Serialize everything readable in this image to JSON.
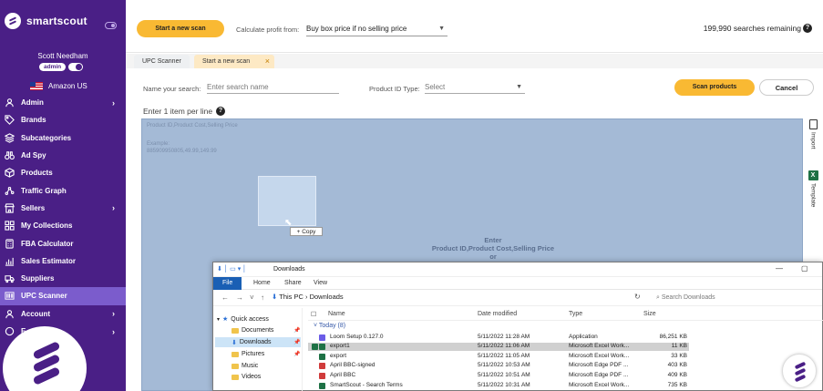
{
  "brand": {
    "name": "smartscout"
  },
  "user": {
    "name": "Scott Needham",
    "role_badge": "admin"
  },
  "marketplace": {
    "label": "Amazon US"
  },
  "sidebar": {
    "items": [
      {
        "label": "Admin",
        "icon": "person-icon",
        "chevron": true
      },
      {
        "label": "Brands",
        "icon": "tag-icon",
        "chevron": false
      },
      {
        "label": "Subcategories",
        "icon": "layers-icon",
        "chevron": false
      },
      {
        "label": "Ad Spy",
        "icon": "binoculars-icon",
        "chevron": false
      },
      {
        "label": "Products",
        "icon": "box-icon",
        "chevron": false
      },
      {
        "label": "Traffic Graph",
        "icon": "graph-icon",
        "chevron": false
      },
      {
        "label": "Sellers",
        "icon": "store-icon",
        "chevron": true
      },
      {
        "label": "My Collections",
        "icon": "grid-icon",
        "chevron": false
      },
      {
        "label": "FBA Calculator",
        "icon": "calculator-icon",
        "chevron": false
      },
      {
        "label": "Sales Estimator",
        "icon": "chart-icon",
        "chevron": false
      },
      {
        "label": "Suppliers",
        "icon": "truck-icon",
        "chevron": false
      },
      {
        "label": "UPC Scanner",
        "icon": "barcode-icon",
        "chevron": false,
        "active": true
      },
      {
        "label": "Account",
        "icon": "person-icon",
        "chevron": true
      },
      {
        "label": "E",
        "icon": "help-icon",
        "chevron": true
      }
    ]
  },
  "topbar": {
    "start_scan_label": "Start a new scan",
    "calc_label": "Calculate profit from:",
    "calc_value": "Buy box price if no selling price",
    "searches_remaining": "199,990 searches remaining"
  },
  "tabs": [
    {
      "label": "UPC Scanner"
    },
    {
      "label": "Start a new scan",
      "closable": true
    }
  ],
  "form": {
    "name_label": "Name your search:",
    "name_placeholder": "Enter search name",
    "idtype_label": "Product ID Type:",
    "idtype_value": "Select",
    "scan_label": "Scan products",
    "cancel_label": "Cancel",
    "enter_label": "Enter 1 item per line"
  },
  "dropzone": {
    "ghost_line1": "Product ID,Product Cost,Selling Price",
    "ghost_line2": "Example:",
    "ghost_line3": "885909950805,49.99,149.99",
    "center_line1": "Enter",
    "center_line2": "Product ID,Product Cost,Selling Price",
    "center_line3": "or",
    "copy_badge": "+ Copy"
  },
  "rail": {
    "import_label": "Import",
    "template_label": "Template"
  },
  "explorer": {
    "title": "Downloads",
    "ribbon": [
      "File",
      "Home",
      "Share",
      "View"
    ],
    "path": "This PC  ›  Downloads",
    "search_placeholder": "Search Downloads",
    "columns": {
      "name": "Name",
      "date": "Date modified",
      "type": "Type",
      "size": "Size"
    },
    "group": "Today (8)",
    "tree": [
      {
        "label": "Quick access",
        "pinned": false
      },
      {
        "label": "Documents",
        "pinned": true
      },
      {
        "label": "Downloads",
        "pinned": true,
        "selected": true
      },
      {
        "label": "Pictures",
        "pinned": true
      },
      {
        "label": "Music",
        "pinned": false
      },
      {
        "label": "Videos",
        "pinned": false
      }
    ],
    "files": [
      {
        "name": "Loom Setup 0.127.0",
        "date": "5/11/2022 11:28 AM",
        "type": "Application",
        "size": "86,251 KB",
        "icon_color": "#6b5ce7"
      },
      {
        "name": "export1",
        "date": "5/11/2022 11:06 AM",
        "type": "Microsoft Excel Work...",
        "size": "11 KB",
        "icon_color": "#1e7145",
        "selected": true
      },
      {
        "name": "export",
        "date": "5/11/2022 11:05 AM",
        "type": "Microsoft Excel Work...",
        "size": "33 KB",
        "icon_color": "#1e7145"
      },
      {
        "name": "April BBC-signed",
        "date": "5/11/2022 10:53 AM",
        "type": "Microsoft Edge PDF ...",
        "size": "403 KB",
        "icon_color": "#d03b3b"
      },
      {
        "name": "April BBC",
        "date": "5/11/2022 10:51 AM",
        "type": "Microsoft Edge PDF ...",
        "size": "409 KB",
        "icon_color": "#d03b3b"
      },
      {
        "name": "SmartScout - Search Terms",
        "date": "5/11/2022 10:31 AM",
        "type": "Microsoft Excel Work...",
        "size": "735 KB",
        "icon_color": "#1e7145"
      }
    ]
  },
  "colors": {
    "sidebar": "#4a1f86",
    "accent": "#f9b933",
    "active_nav": "#7b5ccc"
  }
}
